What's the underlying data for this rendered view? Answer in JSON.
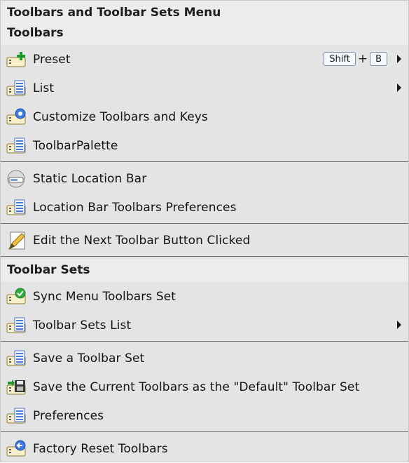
{
  "menu": {
    "title": "Toolbars and Toolbar Sets Menu",
    "sections": [
      {
        "label": "Toolbars"
      },
      {
        "label": "Toolbar Sets"
      }
    ],
    "items": [
      {
        "label": "Preset",
        "icon": "toolbar-add-icon",
        "submenu": true,
        "shortcut": [
          "Shift",
          "B"
        ]
      },
      {
        "label": "List",
        "icon": "toolbar-list-icon",
        "submenu": true
      },
      {
        "label": "Customize Toolbars and Keys",
        "icon": "toolbar-gear-icon"
      },
      {
        "label": "ToolbarPalette",
        "icon": "toolbar-list-icon"
      },
      {
        "label": "Static Location Bar",
        "icon": "location-bar-icon"
      },
      {
        "label": "Location Bar Toolbars Preferences",
        "icon": "toolbar-list-icon"
      },
      {
        "label": "Edit the Next Toolbar Button Clicked",
        "icon": "pencil-note-icon"
      },
      {
        "label": "Sync Menu Toolbars Set",
        "icon": "toolbar-check-icon"
      },
      {
        "label": "Toolbar Sets List",
        "icon": "toolbar-list-icon",
        "submenu": true
      },
      {
        "label": "Save a Toolbar Set",
        "icon": "toolbar-list-icon"
      },
      {
        "label": "Save the Current Toolbars as the \"Default\" Toolbar Set",
        "icon": "toolbar-save-icon"
      },
      {
        "label": "Preferences",
        "icon": "toolbar-list-icon"
      },
      {
        "label": "Factory Reset Toolbars",
        "icon": "toolbar-reset-icon"
      }
    ],
    "shortcut_plus": "+"
  }
}
